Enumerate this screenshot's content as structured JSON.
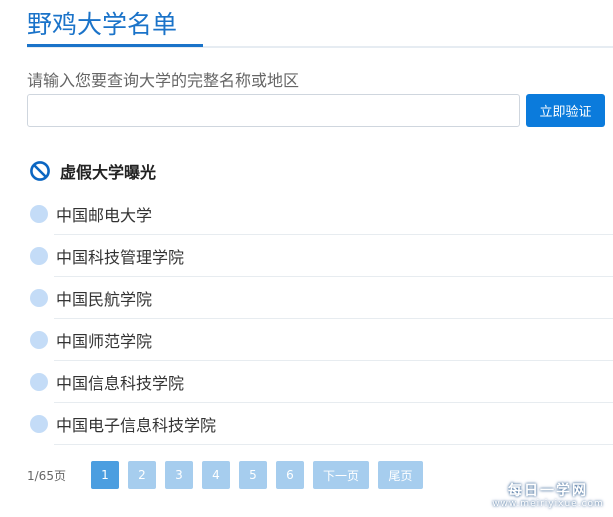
{
  "header": {
    "title": "野鸡大学名单"
  },
  "search": {
    "label": "请输入您要查询大学的完整名称或地区",
    "value": "",
    "placeholder": "",
    "button_label": "立即验证"
  },
  "section": {
    "icon": "ban-icon",
    "title": "虚假大学曝光"
  },
  "universities": [
    "中国邮电大学",
    "中国科技管理学院",
    "中国民航学院",
    "中国师范学院",
    "中国信息科技学院",
    "中国电子信息科技学院"
  ],
  "pagination": {
    "info": "1/65页",
    "pages": [
      "1",
      "2",
      "3",
      "4",
      "5",
      "6"
    ],
    "current": "1",
    "next_label": "下一页",
    "last_label": "尾页"
  },
  "watermark": {
    "main": "每日一学网",
    "sub": "www.meiriyixue.com"
  },
  "colors": {
    "accent": "#1a73c9",
    "button": "#0b7bdc",
    "page_active": "#4c9ee0",
    "page_inactive": "#a6cdee",
    "dot": "#c4dcf7"
  }
}
